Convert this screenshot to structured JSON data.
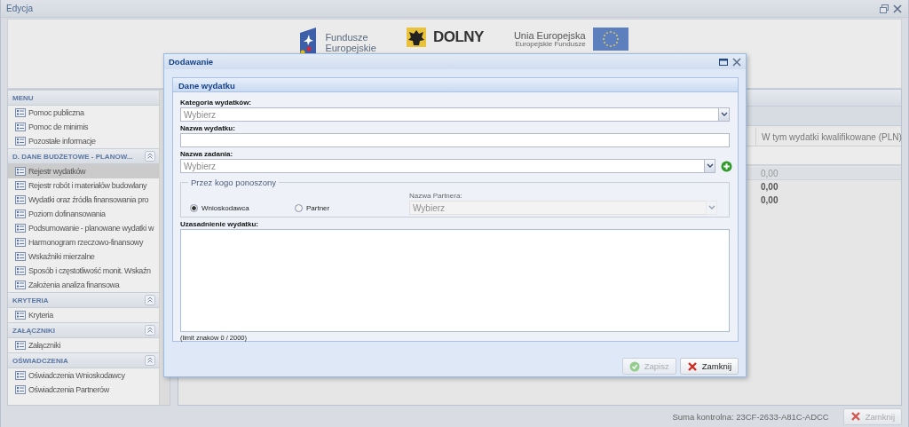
{
  "window": {
    "title": "Edycja"
  },
  "banner": {
    "logos": [
      {
        "kind": "programme",
        "lines": [
          "Fundusze",
          "Europejskie"
        ]
      },
      {
        "kind": "region",
        "lines": [
          "DOLNY"
        ]
      },
      {
        "kind": "union",
        "lines": [
          "Unia Europejska",
          "Europejskie Fundusze"
        ]
      }
    ]
  },
  "sidebar": {
    "sections": [
      {
        "title": "MENU",
        "kind": "menu",
        "items": [
          {
            "label": "Pomoc publiczna",
            "selected": false
          },
          {
            "label": "Pomoc de minimis",
            "selected": false
          },
          {
            "label": "Pozostałe informacje",
            "selected": false
          }
        ]
      },
      {
        "title": "D. DANE BUDŻETOWE - PLANOW...",
        "kind": "group",
        "items": [
          {
            "label": "Rejestr wydatków",
            "selected": true
          },
          {
            "label": "Rejestr robót i materiałów budowlany",
            "selected": false
          },
          {
            "label": "Wydatki oraz źródła finansowania pro",
            "selected": false
          },
          {
            "label": "Poziom dofinansowania",
            "selected": false
          },
          {
            "label": "Podsumowanie - planowane wydatki w",
            "selected": false
          },
          {
            "label": "Harmonogram rzeczowo-finansowy",
            "selected": false
          },
          {
            "label": "Wskaźniki mierzalne",
            "selected": false
          },
          {
            "label": "Sposób i częstotliwość monit. Wskaźn",
            "selected": false
          },
          {
            "label": "Założenia analiza finansowa",
            "selected": false
          }
        ]
      },
      {
        "title": "KRYTERIA",
        "kind": "group",
        "items": [
          {
            "label": "Kryteria",
            "selected": false
          }
        ]
      },
      {
        "title": "ZAŁĄCZNIKI",
        "kind": "group",
        "items": [
          {
            "label": "Załączniki",
            "selected": false
          }
        ]
      },
      {
        "title": "OŚWIADCZENIA",
        "kind": "group",
        "items": [
          {
            "label": "Oświadczenia Wnioskodawcy",
            "selected": false
          },
          {
            "label": "Oświadczenia Partnerów",
            "selected": false
          }
        ]
      }
    ]
  },
  "grid": {
    "columns": [
      "W tym wydatki kwalifikowane (PLN)"
    ],
    "rows": [
      {
        "value": "0,00",
        "kind": "muted"
      },
      {
        "value": "0,00",
        "kind": "bold"
      },
      {
        "value": "0,00",
        "kind": "bold"
      }
    ]
  },
  "dialog": {
    "title": "Dodawanie",
    "panel_title": "Dane wydatku",
    "fields": [
      {
        "kind": "combo",
        "label": "Kategoria wydatków:",
        "placeholder": "Wybierz"
      },
      {
        "kind": "text",
        "label": "Nazwa wydatku:"
      },
      {
        "kind": "combo_add",
        "label": "Nazwa zadania:",
        "placeholder": "Wybierz"
      },
      {
        "kind": "radio_group",
        "legend": "Przez kogo ponoszony",
        "options": [
          {
            "label": "Wnioskodawca",
            "selected": true
          },
          {
            "label": "Partner",
            "selected": false
          }
        ],
        "partner": {
          "label": "Nazwa Partnera:",
          "placeholder": "Wybierz",
          "disabled": true
        }
      },
      {
        "kind": "textarea",
        "label": "Uzasadnienie wydatku:",
        "counter": "(limit znaków 0 / 2000)"
      }
    ],
    "buttons": [
      {
        "kind": "save",
        "label": "Zapisz",
        "disabled": true
      },
      {
        "kind": "close",
        "label": "Zamknij",
        "disabled": false
      }
    ]
  },
  "status_bar": {
    "checksum": "Suma kontrolna: 23CF-2633-A81C-ADCC",
    "button": {
      "label": "Zamknij",
      "disabled": true
    }
  }
}
